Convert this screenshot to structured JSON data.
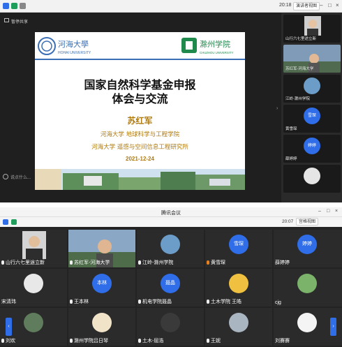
{
  "top": {
    "time": "20:18",
    "view_button": "演讲者视图",
    "share_label": "暂停共享",
    "chat_placeholder": "说点什么..."
  },
  "slide": {
    "logo_left_cn": "河海大學",
    "logo_left_en": "HOHAI UNIVERSITY",
    "logo_right_cn": "滁州学院",
    "logo_right_en": "CHUZHOU UNIVERSITY",
    "title_line1": "国家自然科学基金申报",
    "title_line2": "体会与交流",
    "author": "苏红军",
    "affiliation1": "河海大学 地球科学与工程学院",
    "affiliation2": "河海大学 遥感与空间信息工程研究所",
    "date": "2021-12-24"
  },
  "side_tiles": [
    {
      "name": "山行六七里途立新"
    },
    {
      "name": "苏红军-河海大学"
    },
    {
      "name": "江岭-滁州学院"
    },
    {
      "name": "黄雪琛",
      "avatar": "雪琛"
    },
    {
      "name": "薛婷婷",
      "avatar": "婷婷"
    },
    {
      "name": ""
    }
  ],
  "second": {
    "app_title": "腾讯会议",
    "time": "20:07",
    "view_button": "宫格视图"
  },
  "grid": [
    {
      "name": "山行六七里途立新",
      "avatar": ""
    },
    {
      "name": "苏红军-河海大学",
      "avatar": ""
    },
    {
      "name": "江岭-滁州学院",
      "avatar": ""
    },
    {
      "name": "黄雪琛",
      "avatar": "雪琛"
    },
    {
      "name": "薛婷婷",
      "avatar": "婷婷"
    },
    {
      "name": "宋清玮",
      "avatar": ""
    },
    {
      "name": "王本林",
      "avatar": "本林"
    },
    {
      "name": "机电学院聂晶",
      "avatar": "聂晶"
    },
    {
      "name": "土木学院 王皓",
      "avatar": ""
    },
    {
      "name": "cjg",
      "avatar": ""
    },
    {
      "name": "刘欢",
      "avatar": ""
    },
    {
      "name": "滁州学院吕日琴",
      "avatar": ""
    },
    {
      "name": "土木-屈浩",
      "avatar": ""
    },
    {
      "name": "王妮",
      "avatar": ""
    },
    {
      "name": "刘賽賽",
      "avatar": ""
    }
  ],
  "colors": {
    "accent": "#2f6ee8",
    "slide_text": "#b07a0c",
    "hohai_blue": "#3b6fb5",
    "chuzhou_green": "#1f8a4c"
  }
}
